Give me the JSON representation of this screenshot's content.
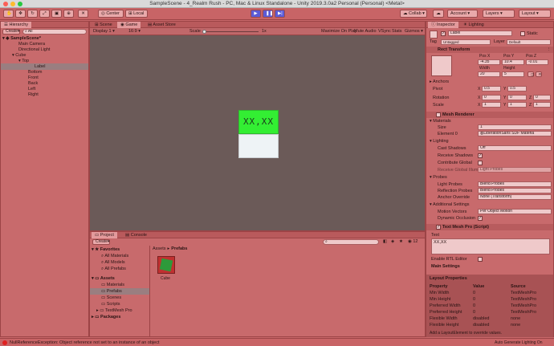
{
  "window": {
    "title": "SampleScene - 4_Realm Rush - PC, Mac & Linux Standalone - Unity 2019.3.0a2 Personal (Personal) <Metal>"
  },
  "toolbar": {
    "center_label": "Center",
    "local_label": "Local",
    "collab_label": "Collab",
    "account_label": "Account",
    "layers_label": "Layers",
    "layout_label": "Layout"
  },
  "hierarchy": {
    "tab_label": "Hierarchy",
    "create_label": "Create",
    "search_placeholder": "All",
    "items": [
      {
        "label": "SampleScene*"
      },
      {
        "label": "Main Camera"
      },
      {
        "label": "Directional Light"
      },
      {
        "label": "Cube"
      },
      {
        "label": "Top"
      },
      {
        "label": "Label"
      },
      {
        "label": "Bottom"
      },
      {
        "label": "Front"
      },
      {
        "label": "Back"
      },
      {
        "label": "Left"
      },
      {
        "label": "Right"
      }
    ]
  },
  "view": {
    "tabs": [
      {
        "label": "Scene"
      },
      {
        "label": "Game"
      },
      {
        "label": "Asset Store"
      }
    ],
    "display_label": "Display 1",
    "aspect_label": "16:9",
    "scale_label": "Scale",
    "scale_value": "1x",
    "options": [
      {
        "label": "Maximize On Play"
      },
      {
        "label": "Mute Audio"
      },
      {
        "label": "VSync"
      },
      {
        "label": "Stats"
      },
      {
        "label": "Gizmos"
      }
    ],
    "cube_label": "XX,XX"
  },
  "project": {
    "tabs": [
      {
        "label": "Project"
      },
      {
        "label": "Console"
      }
    ],
    "create_label": "Create",
    "favorites_label": "Favorites",
    "favorites": [
      {
        "label": "All Materials"
      },
      {
        "label": "All Models"
      },
      {
        "label": "All Prefabs"
      }
    ],
    "assets_label": "Assets",
    "assets": [
      {
        "label": "Materials"
      },
      {
        "label": "Prefabs"
      },
      {
        "label": "Scenes"
      },
      {
        "label": "Scripts"
      },
      {
        "label": "TextMesh Pro"
      }
    ],
    "packages_label": "Packages",
    "breadcrumb_root": "Assets",
    "breadcrumb_sep": "▸",
    "breadcrumb_current": "Prefabs",
    "asset_name": "Cube",
    "count_label": "12"
  },
  "inspector": {
    "tabs": [
      {
        "label": "Inspector"
      },
      {
        "label": "Lighting"
      }
    ],
    "object_name": "Label",
    "static_label": "Static",
    "tag_label": "Tag",
    "tag_value": "Untagged",
    "layer_label": "Layer",
    "layer_value": "Default",
    "rect_transform": {
      "title": "Rect Transform",
      "pos_x_label": "Pos X",
      "pos_y_label": "Pos Y",
      "pos_z_label": "Pos Z",
      "pos_x": "-4.35",
      "pos_y": "10.4",
      "pos_z": "-0.01",
      "width_label": "Width",
      "height_label": "Height",
      "width": "20",
      "height": "5",
      "anchors_label": "Anchors",
      "pivot_label": "Pivot",
      "pivot_x": "0.5",
      "pivot_y": "0.5",
      "rotation_label": "Rotation",
      "rot_x": "0",
      "rot_y": "0",
      "rot_z": "0",
      "scale_label": "Scale",
      "scale_x": "1",
      "scale_y": "1",
      "scale_z": "1"
    },
    "mesh_renderer": {
      "title": "Mesh Renderer",
      "materials_label": "Materials",
      "size_label": "Size",
      "size_value": "1",
      "element0_label": "Element 0",
      "element0_value": "LiberationSans SDF Materia",
      "lighting_label": "Lighting",
      "cast_shadows_label": "Cast Shadows",
      "cast_shadows_value": "Off",
      "receive_shadows_label": "Receive Shadows",
      "contribute_gi_label": "Contribute Global",
      "receive_gi_label": "Receive Global Illum",
      "receive_gi_value": "Light Probes",
      "probes_label": "Probes",
      "light_probes_label": "Light Probes",
      "light_probes_value": "Blend Probes",
      "reflection_probes_label": "Reflection Probes",
      "reflection_probes_value": "Blend Probes",
      "anchor_override_label": "Anchor Override",
      "anchor_override_value": "None (Transform)",
      "additional_label": "Additional Settings",
      "motion_vectors_label": "Motion Vectors",
      "motion_vectors_value": "Per Object Motion",
      "dynamic_occlusion_label": "Dynamic Occlusion"
    },
    "tmp": {
      "title": "Text Mesh Pro (Script)",
      "text_label": "Text",
      "text_value": "XX,XX",
      "enable_rtl_label": "Enable RTL Editor",
      "main_settings_label": "Main Settings"
    },
    "layout_props": {
      "title": "Layout Properties",
      "headers": [
        "Property",
        "Value",
        "Source"
      ],
      "rows": [
        [
          "Min Width",
          "0",
          "TextMeshPro"
        ],
        [
          "Min Height",
          "0",
          "TextMeshPro"
        ],
        [
          "Preferred Width",
          "0",
          "TextMeshPro"
        ],
        [
          "Preferred Height",
          "0",
          "TextMeshPro"
        ],
        [
          "Flexible Width",
          "disabled",
          "none"
        ],
        [
          "Flexible Height",
          "disabled",
          "none"
        ]
      ],
      "hint": "Add a LayoutElement to override values."
    }
  },
  "status": {
    "error": "NullReferenceException: Object reference not set to an instance of an object",
    "right": "Auto Generate Lighting On"
  },
  "colors": {
    "cube_top": "#33ee33",
    "cube_side": "#eef3f6",
    "game_bg": "#6b5a58",
    "tint": "#c8686a"
  }
}
